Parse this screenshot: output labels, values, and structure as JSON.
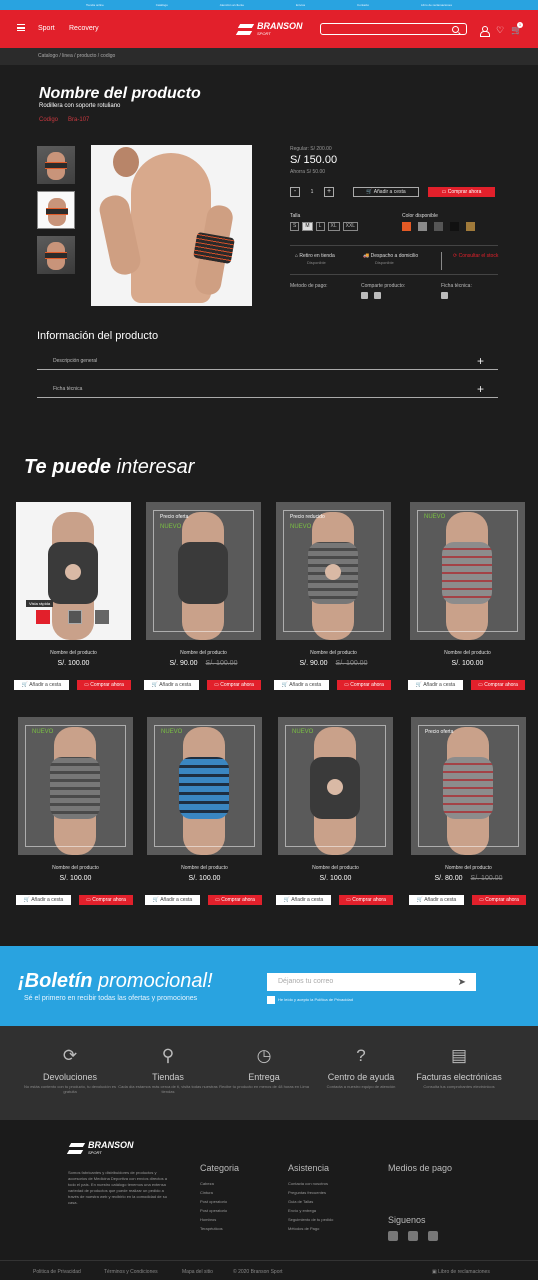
{
  "topbar": [
    "Tienda online",
    "Catálogo",
    "Atención al cliente",
    "Envíos",
    "Contacto",
    "Libro de reclamaciones"
  ],
  "header": {
    "nav": [
      "Sport",
      "Recovery"
    ],
    "logo": "BRANSON",
    "logo_sub": "SPORT",
    "cart_count": "1"
  },
  "breadcrumb": "Catalogo / linea / producto / codigo",
  "product": {
    "title": "Nombre del producto",
    "subtitle": "Rodillera con soporte rotuliano",
    "codigo_label": "Codigo",
    "codigo": "Bra-107",
    "regular": "Regular: S/ 200.00",
    "price": "S/ 150.00",
    "ahorra": "Ahorra S/ 50.00",
    "qty": "1",
    "add": "Añadir a cesta",
    "buy": "Comprar ahora",
    "talla": "Talla",
    "sizes": [
      "S",
      "M",
      "L",
      "XL",
      "XXL"
    ],
    "color_label": "Color disponible",
    "colors": [
      "#e45a25",
      "#8a8a8a",
      "#555555",
      "#1a1a1a",
      "#a07a3a"
    ],
    "ship1": "Retiro en tienda",
    "ship1s": "Disponible",
    "ship2": "Despacho a domicilio",
    "ship2s": "Disponible",
    "ship3": "Consultar el stock",
    "metodo": "Metodo de pago:",
    "comparte": "Comparte producto:",
    "ficha": "Ficha técnica:"
  },
  "info": {
    "title": "Información del producto",
    "items": [
      "Descripción general",
      "Ficha técnica"
    ]
  },
  "interesar": {
    "t1": "Te puede",
    "t2": "interesar"
  },
  "cards": [
    {
      "name": "Nombre del producto",
      "price": "S/. 100.00",
      "old": "",
      "tag": "",
      "nuevo": ""
    },
    {
      "name": "Nombre del producto",
      "price": "S/. 90.00",
      "old": "S/. 100.00",
      "tag": "Precio oferta",
      "nuevo": "NUEVO"
    },
    {
      "name": "Nombre del producto",
      "price": "S/. 90.00",
      "old": "S/. 100.00",
      "tag": "Precio reducido",
      "nuevo": "NUEVO"
    },
    {
      "name": "Nombre del producto",
      "price": "S/. 100.00",
      "old": "",
      "tag": "",
      "nuevo": "NUEVO"
    },
    {
      "name": "Nombre del producto",
      "price": "S/. 100.00",
      "old": "",
      "tag": "",
      "nuevo": "NUEVO"
    },
    {
      "name": "Nombre del producto",
      "price": "S/. 100.00",
      "old": "",
      "tag": "",
      "nuevo": "NUEVO"
    },
    {
      "name": "Nombre del producto",
      "price": "S/. 100.00",
      "old": "",
      "tag": "",
      "nuevo": "NUEVO"
    },
    {
      "name": "Nombre del producto",
      "price": "S/. 80.00",
      "old": "S/. 100.00",
      "tag": "Precio oferta",
      "nuevo": ""
    }
  ],
  "card_add": "Añadir a cesta",
  "card_buy": "Comprar ahora",
  "vista": "Vista rápida",
  "news": {
    "t1": "¡Boletín",
    "t2": "promocional!",
    "sub": "Sé el primero en recibir todas las ofertas y promociones",
    "placeholder": "Déjanos tu correo",
    "check": "He leído y acepto la Política de Privacidad"
  },
  "features": [
    {
      "t": "Devoluciones",
      "d": "No estás contento con tu producto, tu devolución es gratuita"
    },
    {
      "t": "Tiendas",
      "d": "Cada día estamos más cerca de ti, visita todas nuestras tiendas"
    },
    {
      "t": "Entrega",
      "d": "Recibe tu producto en menos de 48 horas en Lima"
    },
    {
      "t": "Centro de ayuda",
      "d": "Contacta a nuestro equipo de atención"
    },
    {
      "t": "Facturas electrónicas",
      "d": "Consulta tus comprobantes electrónicos"
    }
  ],
  "footer": {
    "desc": "Somos fabricantes y distribuidores de productos y accesorios de Medicina Deportiva con envíos directos a todo el país. En nuestro catálogo tenemos una extensa variedad de productos que puede realizar un pedido a través de nuestra web y recibirlo en la comodidad de su casa.",
    "cat": "Categoria",
    "cat_items": [
      "Cabeza",
      "Cintura",
      "Post operatorio",
      "Post operatorio",
      "Hombros",
      "Terapéuticos"
    ],
    "asis": "Asistencia",
    "asis_items": [
      "Contacta con nosotros",
      "Preguntas frecuentes",
      "Guia de Tallas",
      "Envío y entrega",
      "Seguimiento de tu pedido",
      "Métodos de Pago"
    ],
    "medios": "Medios de pago",
    "siguenos": "Siguenos"
  },
  "bottom": [
    "Politica de Privacidad",
    "Términos y Condiciones",
    "Mapa del sitio",
    "© 2020 Branson Sport",
    "Libro de reclamaciones"
  ]
}
